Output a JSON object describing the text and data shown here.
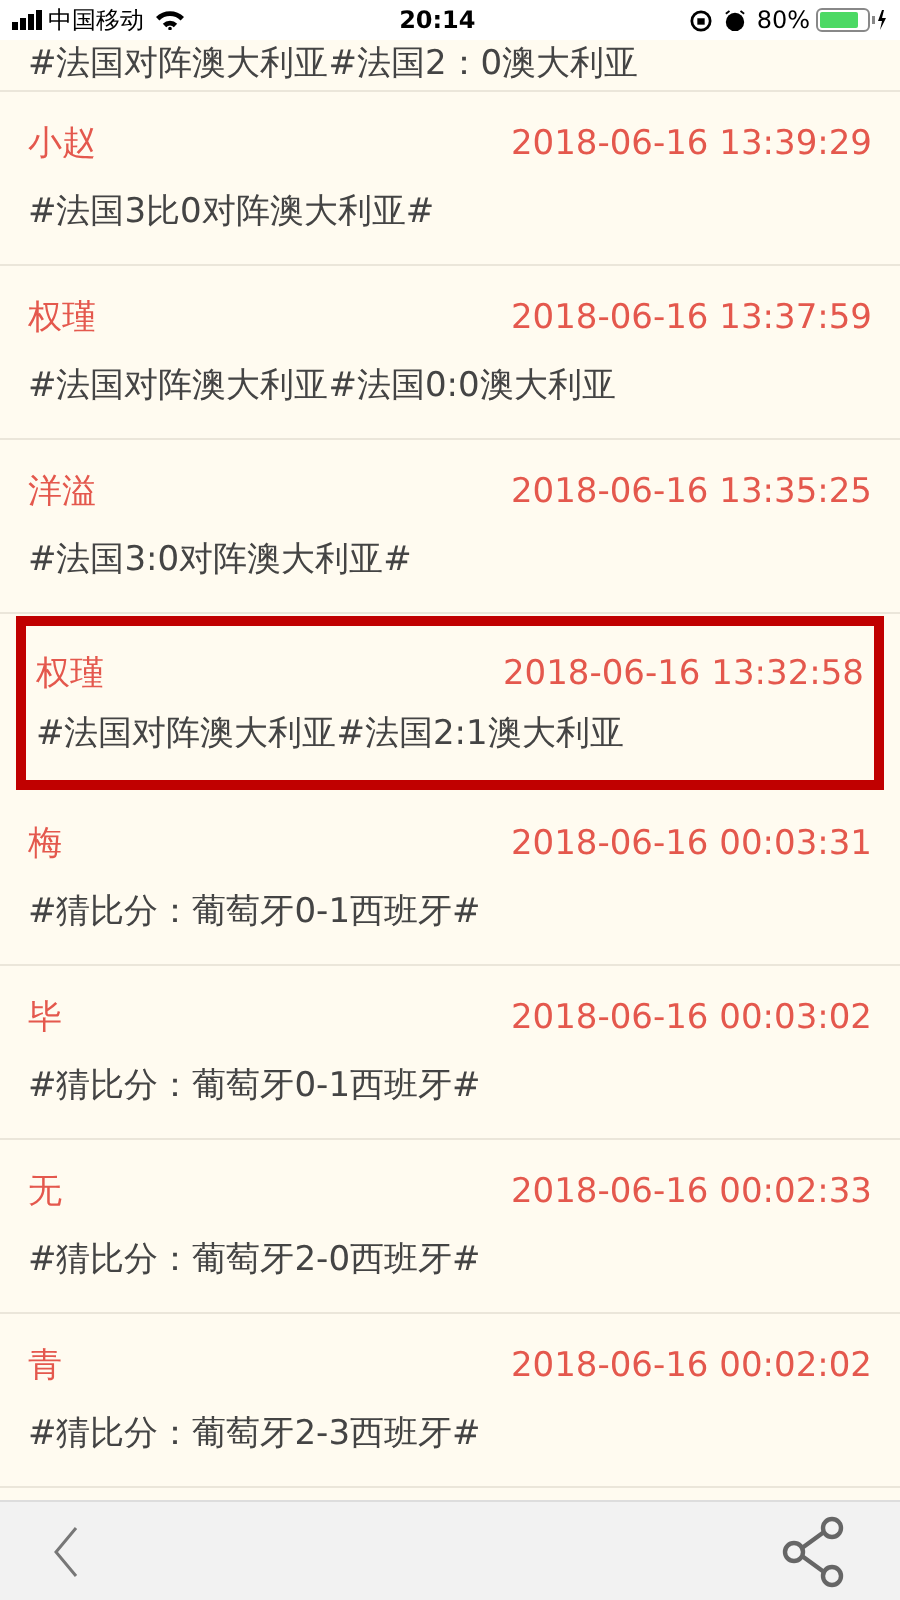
{
  "status_bar": {
    "carrier": "中国移动",
    "time": "20:14",
    "battery": "80%"
  },
  "partial_post": {
    "text": "#法国对阵澳大利亚#法国2：0澳大利亚"
  },
  "posts": [
    {
      "author": "小赵",
      "time": "2018-06-16 13:39:29",
      "text": "#法国3比0对阵澳大利亚#",
      "highlighted": false
    },
    {
      "author": "权瑾",
      "time": "2018-06-16 13:37:59",
      "text": "#法国对阵澳大利亚#法国0:0澳大利亚",
      "highlighted": false
    },
    {
      "author": "洋溢",
      "time": "2018-06-16 13:35:25",
      "text": "#法国3:0对阵澳大利亚#",
      "highlighted": false
    },
    {
      "author": "权瑾",
      "time": "2018-06-16 13:32:58",
      "text": "#法国对阵澳大利亚#法国2:1澳大利亚",
      "highlighted": true
    },
    {
      "author": "梅",
      "time": "2018-06-16 00:03:31",
      "text": "#猜比分：葡萄牙0-1西班牙#",
      "highlighted": false
    },
    {
      "author": "毕",
      "time": "2018-06-16 00:03:02",
      "text": "#猜比分：葡萄牙0-1西班牙#",
      "highlighted": false
    },
    {
      "author": "无",
      "time": "2018-06-16 00:02:33",
      "text": "#猜比分：葡萄牙2-0西班牙#",
      "highlighted": false
    },
    {
      "author": "青",
      "time": "2018-06-16 00:02:02",
      "text": "#猜比分：葡萄牙2-3西班牙#",
      "highlighted": false
    }
  ]
}
